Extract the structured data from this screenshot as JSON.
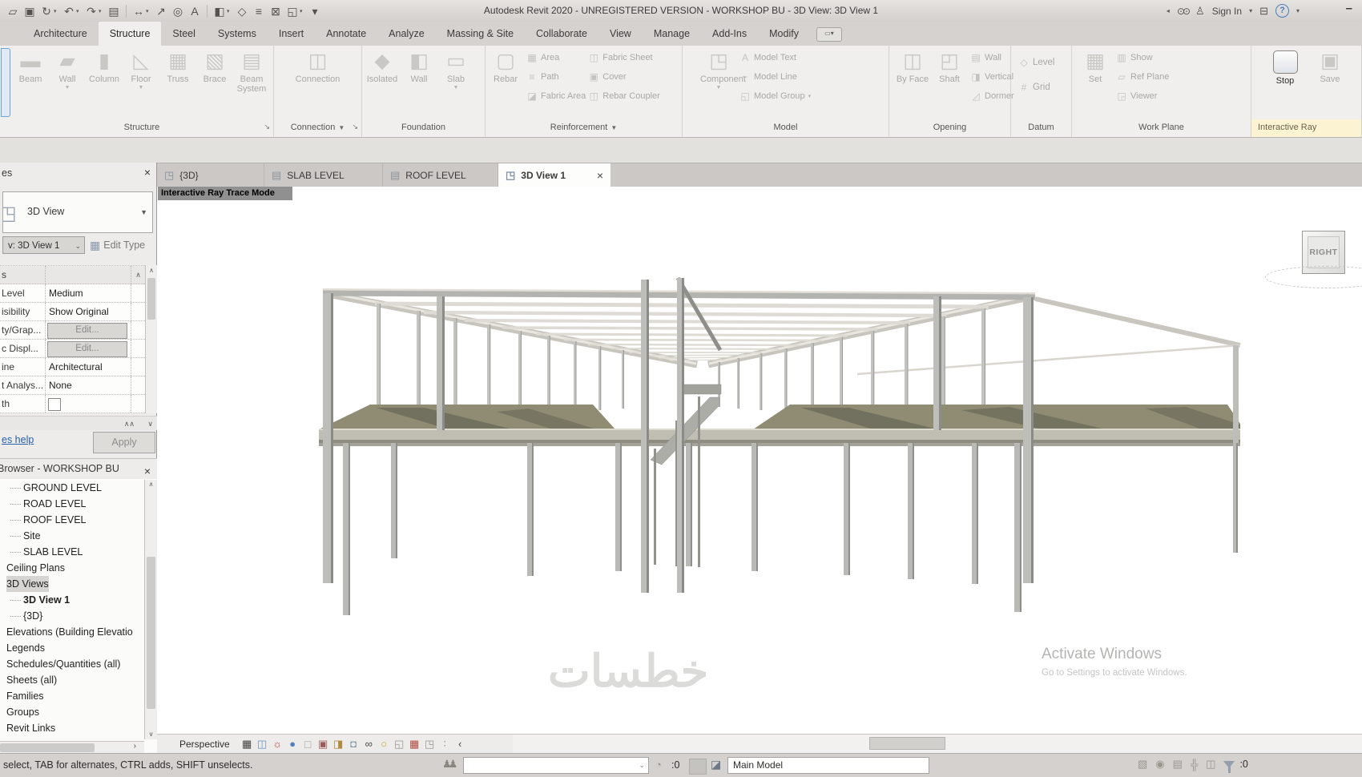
{
  "title_bar": {
    "title": "Autodesk Revit 2020 - UNREGISTERED VERSION - WORKSHOP BU - 3D View: 3D View 1",
    "sign_in": "Sign In",
    "qat_items": [
      {
        "name": "open-icon"
      },
      {
        "name": "save-icon"
      },
      {
        "name": "sync-with-central-icon",
        "arrow": true
      },
      {
        "name": "undo-icon",
        "arrow": true
      },
      {
        "name": "redo-icon",
        "arrow": true
      },
      {
        "name": "print-icon"
      },
      {
        "sep": true
      },
      {
        "name": "measure-icon",
        "arrow": true
      },
      {
        "name": "aligned-dimension-icon"
      },
      {
        "name": "tag-by-category-icon"
      },
      {
        "name": "text-icon"
      },
      {
        "sep": true
      },
      {
        "name": "default-3d-view-icon",
        "arrow": true
      },
      {
        "name": "section-icon"
      },
      {
        "name": "thin-lines-icon"
      },
      {
        "name": "close-hidden-windows-icon"
      },
      {
        "name": "switch-windows-icon",
        "arrow": true
      },
      {
        "name": "customize-qat-icon"
      }
    ]
  },
  "ribbon": {
    "tabs": [
      "Architecture",
      "Structure",
      "Steel",
      "Systems",
      "Insert",
      "Annotate",
      "Analyze",
      "Massing & Site",
      "Collaborate",
      "View",
      "Manage",
      "Add-Ins",
      "Modify"
    ],
    "active_tab": "Structure",
    "panels": [
      {
        "label": "Structure",
        "dialog_launcher": true,
        "buttons": [
          {
            "label": "Beam",
            "icon": "beam-icon"
          },
          {
            "label": "Wall",
            "icon": "wall-icon",
            "arrow": true
          },
          {
            "label": "Column",
            "icon": "column-icon"
          },
          {
            "label": "Floor",
            "icon": "floor-icon",
            "arrow": true
          },
          {
            "label": "Truss",
            "icon": "truss-icon"
          },
          {
            "label": "Brace",
            "icon": "brace-icon"
          },
          {
            "label": "Beam System",
            "icon": "beam-system-icon"
          }
        ]
      },
      {
        "label": "Connection",
        "label_arrow": true,
        "dialog_launcher": true,
        "buttons": [
          {
            "label": "Connection",
            "icon": "connection-icon"
          }
        ]
      },
      {
        "label": "Foundation",
        "buttons": [
          {
            "label": "Isolated",
            "icon": "isolated-foundation-icon"
          },
          {
            "label": "Wall",
            "icon": "wall-foundation-icon"
          },
          {
            "label": "Slab",
            "icon": "slab-foundation-icon",
            "arrow": true
          }
        ]
      },
      {
        "label": "Reinforcement",
        "label_arrow": true,
        "big": [
          {
            "label": "Rebar",
            "icon": "rebar-icon"
          }
        ],
        "small_cols": [
          [
            {
              "label": "Area",
              "icon": "rebar-area-icon"
            },
            {
              "label": "Path",
              "icon": "rebar-path-icon"
            },
            {
              "label": "Fabric Area",
              "icon": "fabric-area-icon"
            }
          ],
          [
            {
              "label": "Fabric Sheet",
              "icon": "fabric-sheet-icon"
            },
            {
              "label": "Cover",
              "icon": "cover-icon"
            },
            {
              "label": "Rebar Coupler",
              "icon": "rebar-coupler-icon"
            }
          ]
        ]
      },
      {
        "label": "Model",
        "big": [
          {
            "label": "Component",
            "icon": "component-icon",
            "arrow": true
          }
        ],
        "small_cols": [
          [
            {
              "label": "Model Text",
              "icon": "model-text-icon"
            },
            {
              "label": "Model Line",
              "icon": "model-line-icon"
            },
            {
              "label": "Model Group",
              "icon": "model-group-icon",
              "arrow": true
            }
          ]
        ]
      },
      {
        "label": "Opening",
        "big": [
          {
            "label": "By Face",
            "icon": "opening-by-face-icon"
          },
          {
            "label": "Shaft",
            "icon": "shaft-opening-icon"
          }
        ],
        "small_cols": [
          [
            {
              "label": "Wall",
              "icon": "wall-opening-icon"
            },
            {
              "label": "Vertical",
              "icon": "vertical-opening-icon"
            },
            {
              "label": "Dormer",
              "icon": "dormer-opening-icon"
            }
          ]
        ]
      },
      {
        "label": "Datum",
        "big": [],
        "small_cols": [
          [
            {
              "label": "Level",
              "icon": "level-icon"
            },
            {
              "label": "Grid",
              "icon": "grid-icon"
            }
          ]
        ]
      },
      {
        "label": "Work Plane",
        "big": [
          {
            "label": "Set",
            "icon": "set-work-plane-icon"
          }
        ],
        "small_cols": [
          [
            {
              "label": "Show",
              "icon": "show-work-plane-icon"
            },
            {
              "label": "Ref Plane",
              "icon": "ref-plane-icon"
            },
            {
              "label": "Viewer",
              "icon": "viewer-icon"
            }
          ]
        ]
      },
      {
        "label": "Interactive Ray",
        "highlight": true,
        "buttons": [
          {
            "label": "Stop",
            "icon": "stop-icon",
            "enabled": true
          },
          {
            "label": "Save",
            "icon": "save-render-icon"
          }
        ]
      }
    ]
  },
  "view_tabs": [
    {
      "label": "{3D}",
      "icon": "cube-icon"
    },
    {
      "label": "SLAB LEVEL",
      "icon": "plan-icon"
    },
    {
      "label": "ROOF LEVEL",
      "icon": "plan-icon"
    },
    {
      "label": "3D View 1",
      "icon": "cube-icon",
      "active": true
    }
  ],
  "viewport": {
    "mode_label": "Interactive Ray Trace Mode",
    "viewcube_face": "RIGHT",
    "watermark_line1": "Activate Windows",
    "watermark_line2": "Go to Settings to activate Windows.",
    "center_watermark": "خطسات"
  },
  "properties": {
    "header": "es",
    "type_selector": "3D View",
    "view_combo": "v: 3D View 1",
    "edit_type": "Edit Type",
    "group_header": "s",
    "rows": [
      {
        "label": "Level",
        "value": "Medium",
        "type": "text"
      },
      {
        "label": "isibility",
        "value": "Show Original",
        "type": "text"
      },
      {
        "label": "ty/Grap...",
        "value": "Edit...",
        "type": "button"
      },
      {
        "label": "c Displ...",
        "value": "Edit...",
        "type": "button"
      },
      {
        "label": "ine",
        "value": "Architectural",
        "type": "text"
      },
      {
        "label": "t Analys...",
        "value": "None",
        "type": "text"
      },
      {
        "label": "th",
        "value": "",
        "type": "check"
      }
    ],
    "help_link": "es help",
    "apply_label": "Apply"
  },
  "browser": {
    "header": "Browser - WORKSHOP BU",
    "items": [
      {
        "label": "GROUND LEVEL",
        "indent": 2,
        "conn": true
      },
      {
        "label": "ROAD LEVEL",
        "indent": 2,
        "conn": true
      },
      {
        "label": "ROOF LEVEL",
        "indent": 2,
        "conn": true
      },
      {
        "label": "Site",
        "indent": 2,
        "conn": true
      },
      {
        "label": "SLAB LEVEL",
        "indent": 2,
        "conn": true
      },
      {
        "label": "Ceiling Plans",
        "indent": 1
      },
      {
        "label": "3D Views",
        "indent": 1,
        "selected": true
      },
      {
        "label": "3D View 1",
        "indent": 2,
        "conn": true,
        "bold": true
      },
      {
        "label": "{3D}",
        "indent": 2,
        "conn": true
      },
      {
        "label": "Elevations (Building Elevatio",
        "indent": 1
      },
      {
        "label": "Legends",
        "indent": 1
      },
      {
        "label": "Schedules/Quantities (all)",
        "indent": 1
      },
      {
        "label": "Sheets (all)",
        "indent": 1
      },
      {
        "label": "Families",
        "indent": 1
      },
      {
        "label": "Groups",
        "indent": 1
      },
      {
        "label": "Revit Links",
        "indent": 1
      }
    ]
  },
  "view_control_bar": {
    "scale_label": "Perspective",
    "icons": [
      "visual-style-icon",
      "sun-path-icon",
      "shadows-icon",
      "render-dialog-icon",
      "crop-dim-icon",
      "crop-region-icon",
      "crop-visibility-icon",
      "locked-view-icon",
      "temporary-hide-isolate-icon",
      "reveal-hidden-elements-icon",
      "temporary-view-properties-icon",
      "worksharing-display-icon",
      "displaced-elements-icon",
      "reveal-constraints-icon",
      "collapse-icon"
    ]
  },
  "status_bar": {
    "message": "select, TAB for alternates, CTRL adds, SHIFT unselects.",
    "workset_combo_value": "",
    "editing_requests_count": ":0",
    "active_design_option": "Main Model",
    "right_icons": [
      "select-links-icon",
      "select-pinned-icon",
      "select-underlay-icon",
      "drag-on-selection-icon",
      "background-processes-icon"
    ],
    "filter_count": ":0"
  }
}
